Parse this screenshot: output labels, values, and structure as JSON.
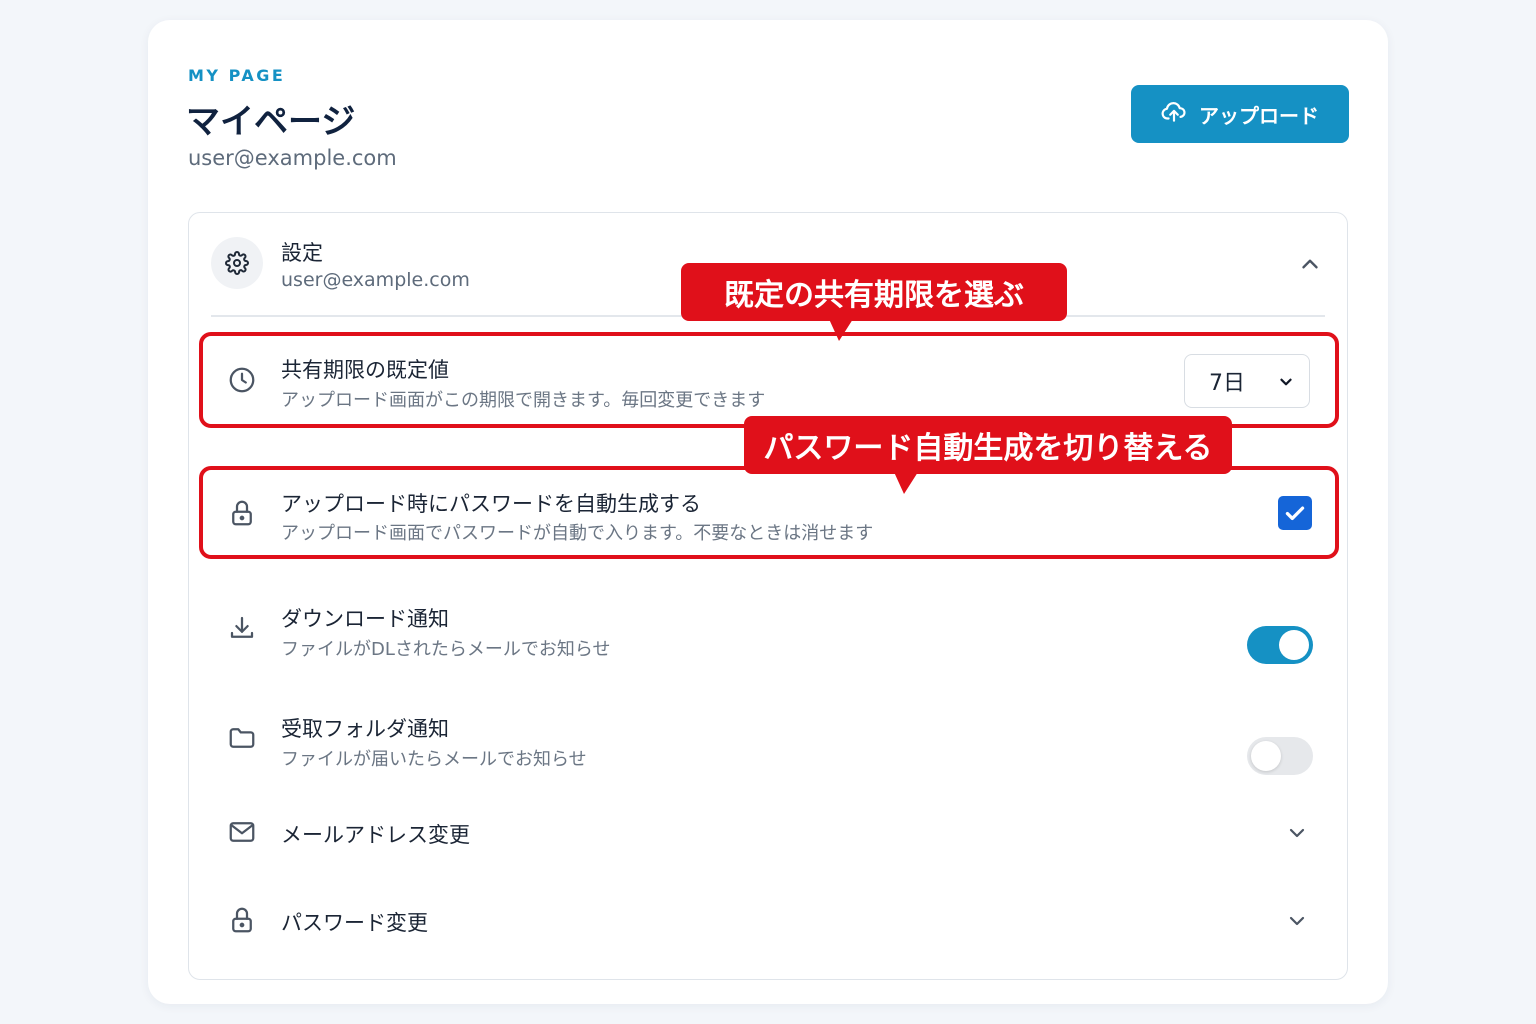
{
  "header": {
    "eyebrow": "MY PAGE",
    "title": "マイページ",
    "email": "user@example.com",
    "upload_label": "アップロード",
    "upload_icon": "cloud-upload-icon"
  },
  "settings_panel": {
    "title": "設定",
    "subtitle": "user@example.com",
    "icon": "gear-icon",
    "rows": {
      "share_period": {
        "title": "共有期限の既定値",
        "description": "アップロード画面がこの期限で開きます。毎回変更できます",
        "selected_value": "7日",
        "icon": "clock-icon"
      },
      "auto_password": {
        "title": "アップロード時にパスワードを自動生成する",
        "description": "アップロード画面でパスワードが自動で入ります。不要なときは消せます",
        "checked": true,
        "icon": "lock-icon"
      },
      "download_notify": {
        "title": "ダウンロード通知",
        "description": "ファイルがDLされたらメールでお知らせ",
        "enabled": true,
        "icon": "download-icon"
      },
      "inbox_notify": {
        "title": "受取フォルダ通知",
        "description": "ファイルが届いたらメールでお知らせ",
        "enabled": false,
        "icon": "folder-icon"
      },
      "email_change": {
        "title": "メールアドレス変更",
        "icon": "mail-icon"
      },
      "password_change": {
        "title": "パスワード変更",
        "icon": "lock-icon"
      }
    }
  },
  "callouts": {
    "share_period": "既定の共有期限を選ぶ",
    "auto_password": "パスワード自動生成を切り替える"
  },
  "colors": {
    "accent": "#1591c4",
    "highlight": "#e0101a",
    "checkbox": "#1565d8"
  }
}
